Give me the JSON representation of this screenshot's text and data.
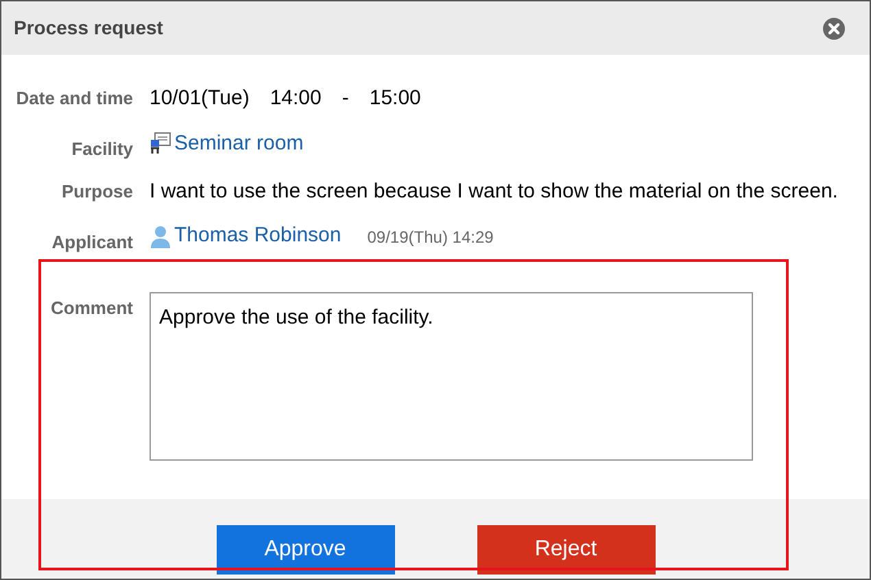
{
  "dialog": {
    "title": "Process request"
  },
  "fields": [
    {
      "label": "Date and time",
      "kind": "text",
      "value": "10/01(Tue)　14:00　-　15:00"
    },
    {
      "label": "Facility",
      "kind": "facility",
      "value": "Seminar room"
    },
    {
      "label": "Purpose",
      "kind": "text",
      "value": "I want to use the screen because I want to show the material on the screen."
    },
    {
      "label": "Applicant",
      "kind": "user",
      "value": "Thomas Robinson",
      "timestamp": "09/19(Thu) 14:29"
    }
  ],
  "comment": {
    "label": "Comment",
    "value": "Approve the use of the facility."
  },
  "buttons": [
    {
      "label": "Approve",
      "kind": "approve"
    },
    {
      "label": "Reject",
      "kind": "reject"
    }
  ]
}
